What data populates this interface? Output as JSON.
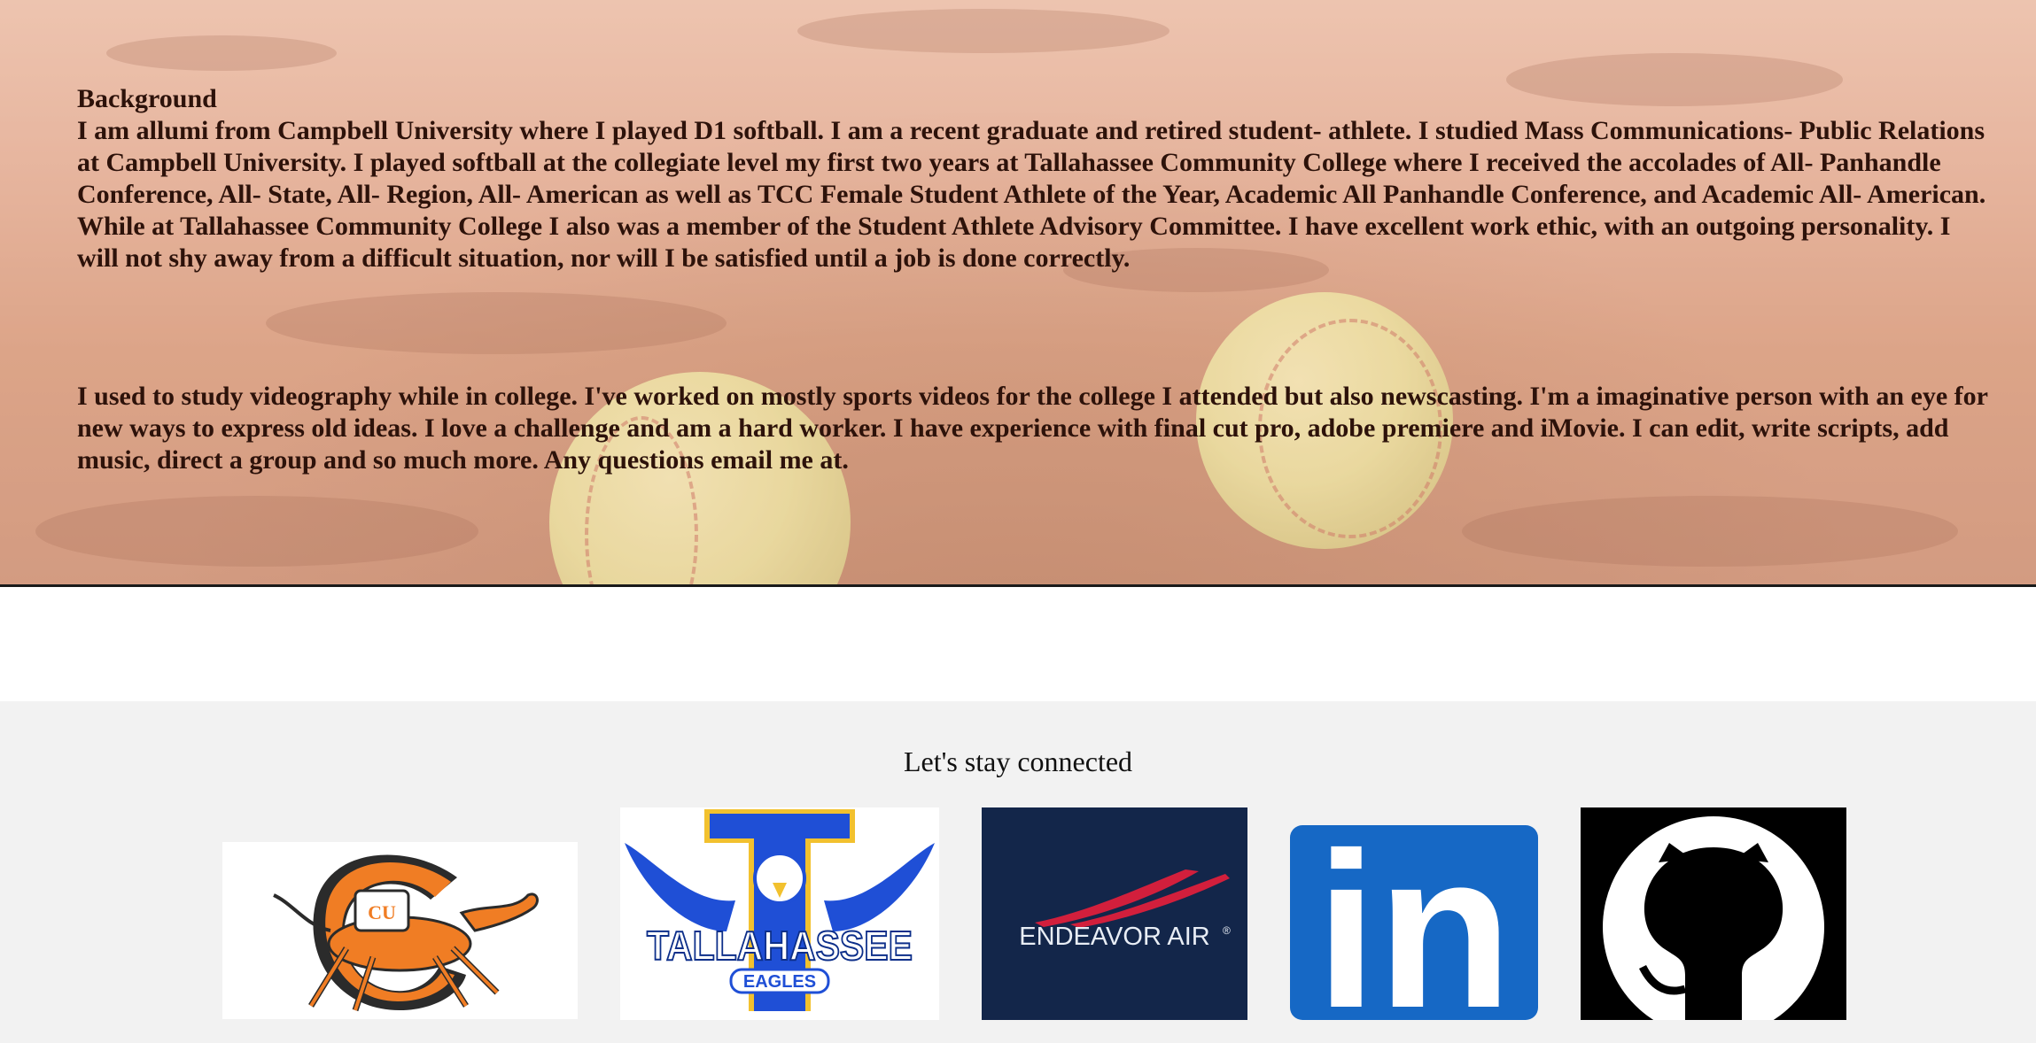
{
  "about": {
    "heading": "Background",
    "paragraph1": "I am allumi from Campbell University where I played D1 softball. I am a recent graduate and retired student- athlete. I studied Mass Communications- Public Relations at Campbell University. I played softball at the collegiate level my first two years at Tallahassee Community College where I received the accolades of All- Panhandle Conference, All- State, All- Region, All- American as well as TCC Female Student Athlete of the Year, Academic All Panhandle Conference, and Academic All- American. While at Tallahassee Community College I also was a member of the Student Athlete Advisory Committee. I have excellent work ethic, with an outgoing personality. I will not shy away from a difficult situation, nor will I be satisfied until a job is done correctly.",
    "paragraph2": "I used to study videography while in college. I've worked on mostly sports videos for the college I attended but also newscasting. I'm a imaginative person with an eye for new ways to express old ideas. I love a challenge and am a hard worker. I have experience with final cut pro, adobe premiere and iMovie. I can edit, write scripts, add music, direct a group and so much more. Any questions email me at."
  },
  "footer": {
    "title": "Let's stay connected",
    "logos": [
      {
        "name": "campbell-camel-logo",
        "letters": "CU"
      },
      {
        "name": "tallahassee-eagles-logo",
        "wordmark": "TALLAHASSEE",
        "sub": "EAGLES",
        "letter": "T"
      },
      {
        "name": "endeavor-air-logo",
        "wordmark": "ENDEAVOR AIR",
        "mark": "®"
      },
      {
        "name": "linkedin-logo",
        "wordmark": "in"
      },
      {
        "name": "github-logo"
      }
    ]
  },
  "colors": {
    "bio_text": "#2d120a",
    "footer_bg": "#f2f2f2",
    "endeavor_bg": "#13264a",
    "linkedin_blue": "#1668c5",
    "tally_blue": "#1f4fd6",
    "tally_gold": "#f2c12e",
    "campbell_orange": "#f07d24"
  }
}
